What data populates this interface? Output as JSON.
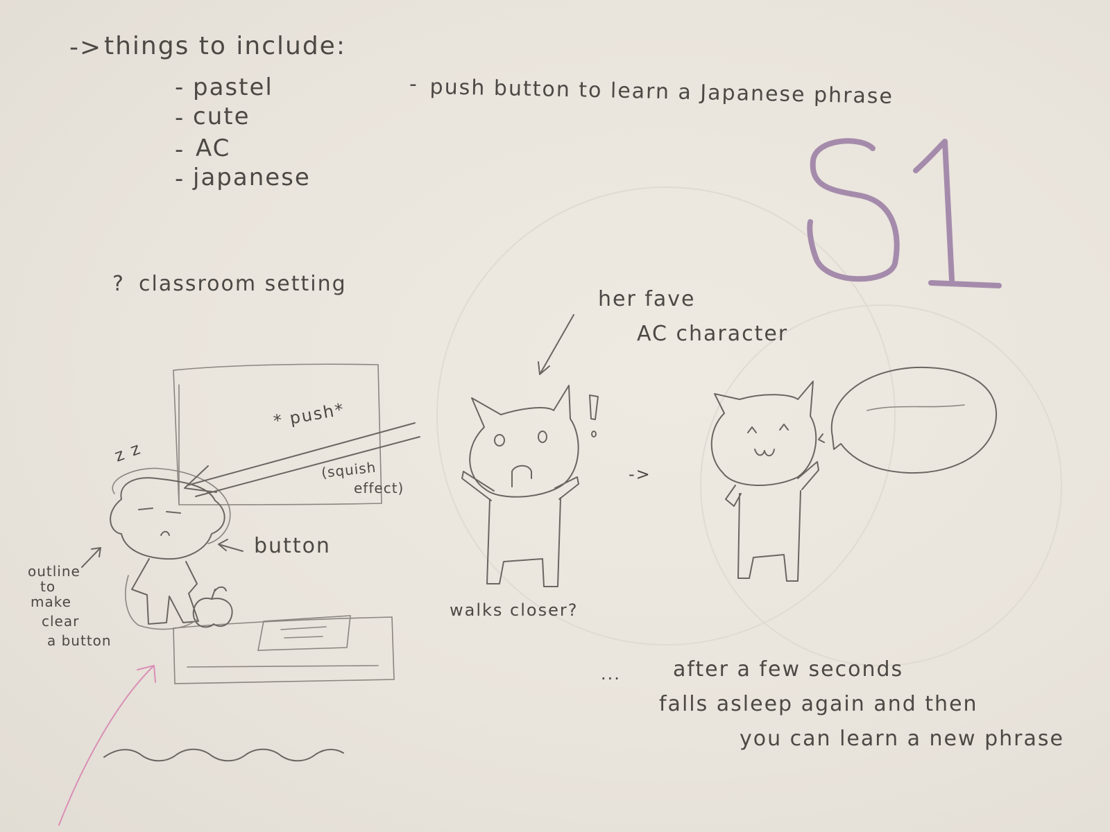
{
  "header": {
    "arrow": "->",
    "title": "things to include:"
  },
  "include_list": [
    {
      "dash": "-",
      "text": "pastel"
    },
    {
      "dash": "-",
      "text": "cute"
    },
    {
      "dash": "-",
      "text": "AC"
    },
    {
      "dash": "-",
      "text": "japanese"
    }
  ],
  "idea": {
    "dash": "-",
    "text": "push button to learn a Japanese phrase"
  },
  "sketch_id": "S1",
  "setting": {
    "mark": "?",
    "text": "classroom setting"
  },
  "annotations": {
    "her_fave_line1": "her fave",
    "her_fave_line2": "AC character",
    "push": "* push*",
    "squish_line1": "(squish",
    "squish_line2": "effect)",
    "button": "button",
    "zzz": "z z",
    "outline_note": [
      "outline",
      "to",
      "make",
      "clear",
      "a button"
    ],
    "walks_closer": "walks closer?",
    "transition_arrow": "->",
    "exclaim": "!",
    "ellipsis": "...",
    "after_line1": "after a few seconds",
    "after_line2": "falls asleep again and then",
    "after_line3": "you can learn a new phrase"
  }
}
